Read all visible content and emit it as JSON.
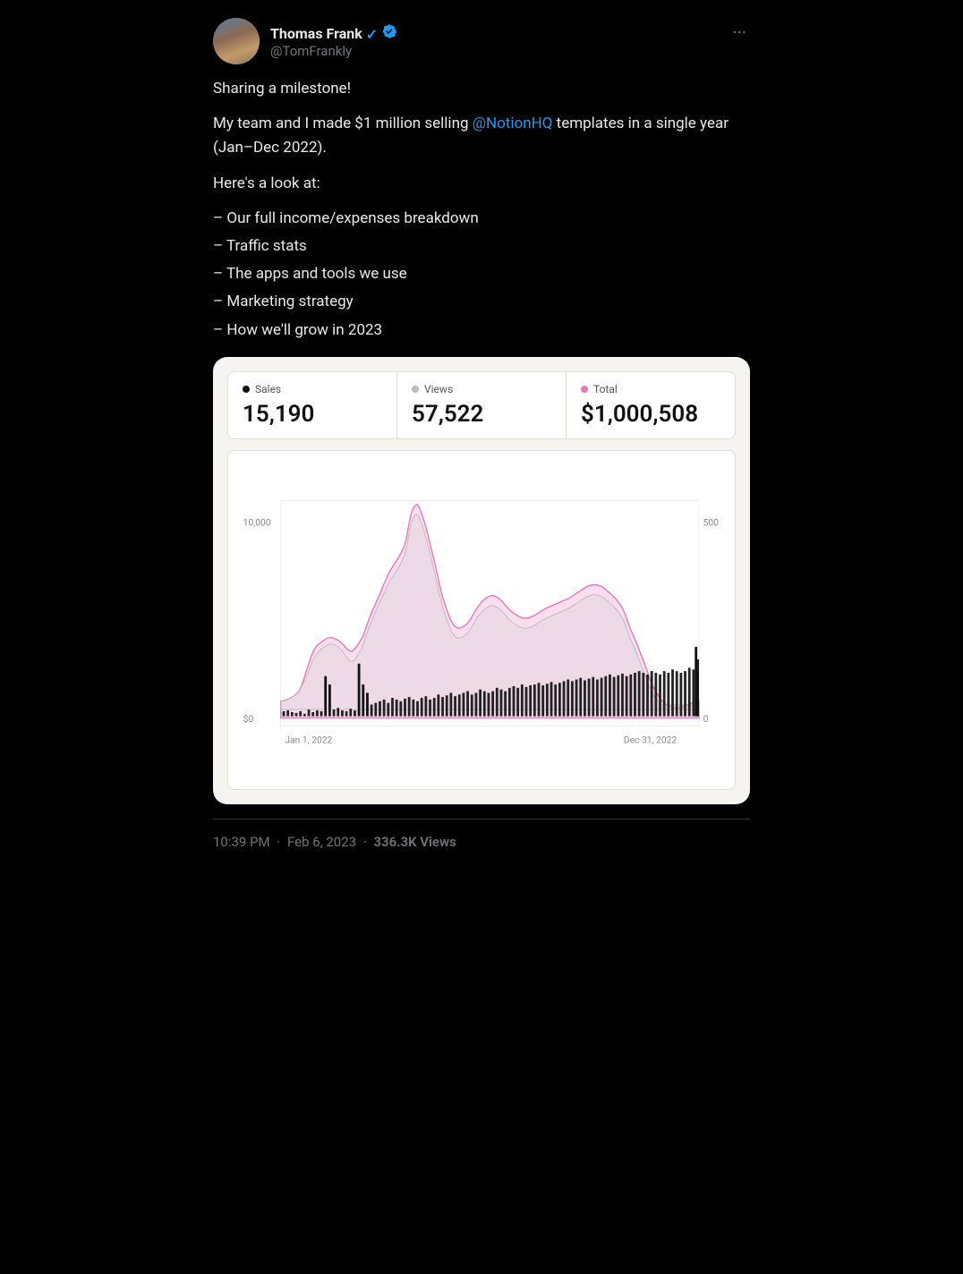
{
  "tweet": {
    "author": {
      "display_name": "Thomas Frank",
      "username": "@TomFrankly",
      "verified": true
    },
    "more_button_label": "···",
    "content": {
      "intro": "Sharing a milestone!",
      "body": "My team and I made $1 million selling",
      "mention": "@NotionHQ",
      "body_cont": "templates in a single year (Jan–Dec 2022).",
      "look_at": "Here's a look at:",
      "list": [
        "– Our full income/expenses breakdown",
        "– Traffic stats",
        "– The apps and tools we use",
        "– Marketing strategy",
        "– How we'll grow in 2023"
      ]
    },
    "stats": {
      "sales": {
        "label": "Sales",
        "value": "15,190",
        "dot_type": "black"
      },
      "views": {
        "label": "Views",
        "value": "57,522",
        "dot_type": "gray"
      },
      "total": {
        "label": "Total",
        "value": "$1,000,508",
        "dot_type": "pink"
      }
    },
    "chart": {
      "x_start": "Jan 1, 2022",
      "x_end": "Dec 31, 2022",
      "y_left_label": "10,000",
      "y_left_bottom": "$0",
      "y_right_label": "500",
      "y_right_bottom": "0"
    },
    "footer": {
      "time": "10:39 PM",
      "dot": "·",
      "date": "Feb 6, 2023",
      "dot2": "·",
      "views": "336.3K Views"
    }
  }
}
